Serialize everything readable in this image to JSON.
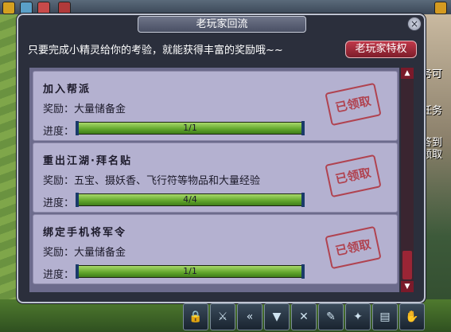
{
  "dialog": {
    "title": "老玩家回流",
    "close_label": "×",
    "intro": "只要完成小精灵给你的考验，就能获得丰富的奖励哦~~",
    "veteran_button": "老玩家特权"
  },
  "tasks": [
    {
      "title": "加入帮派",
      "reward": "奖励：大量储备金",
      "progress_label": "进度：",
      "progress_text": "1/1",
      "progress": 1.0,
      "stamp": "已领取"
    },
    {
      "title": "重出江湖·拜名贴",
      "reward": "奖励：五宝、摄妖香、飞行符等物品和大量经验",
      "progress_label": "进度：",
      "progress_text": "4/4",
      "progress": 1.0,
      "stamp": "已领取"
    },
    {
      "title": "绑定手机将军令",
      "reward": "奖励：大量储备金",
      "progress_label": "进度：",
      "progress_text": "1/1",
      "progress": 1.0,
      "stamp": "已领取"
    }
  ],
  "scrollbar": {
    "up": "▲",
    "down": "▼"
  },
  "side_texts": [
    "务可",
    "任务",
    "答到",
    "领取"
  ],
  "toolbar_icons": [
    "lock-icon",
    "sword-icon",
    "double-arrow-icon",
    "bag-icon",
    "swords-icon",
    "scroll-icon",
    "skill-icon",
    "map-icon",
    "hand-icon"
  ]
}
